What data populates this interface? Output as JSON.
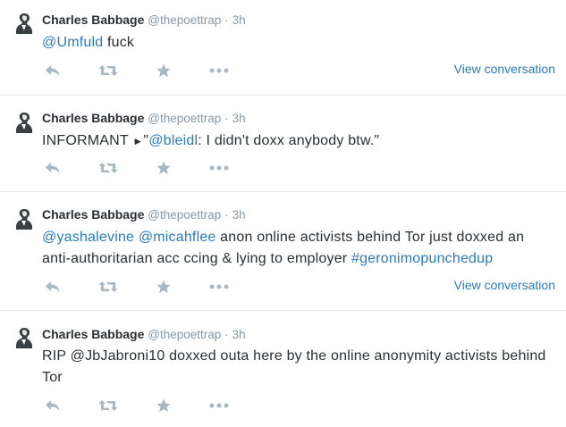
{
  "colors": {
    "link": "#2b7bb9",
    "muted": "#aab8c2",
    "text": "#292f33",
    "divider": "#e1e8ed"
  },
  "icons": {
    "reply": "reply-icon",
    "retweet": "retweet-icon",
    "favorite": "star-icon",
    "more": "more-icon"
  },
  "tweets": [
    {
      "author": {
        "name": "Charles Babbage",
        "handle": "@thepoettrap"
      },
      "separator": "·",
      "time": "3h",
      "text": [
        "@Umfuld",
        " fuck"
      ],
      "view_conversation": "View conversation"
    },
    {
      "author": {
        "name": "Charles Babbage",
        "handle": "@thepoettrap"
      },
      "separator": "·",
      "time": "3h",
      "text": [
        "INFORMANT ",
        "►",
        "\"",
        "@bleidl",
        ": I didn't doxx anybody btw.\""
      ]
    },
    {
      "author": {
        "name": "Charles Babbage",
        "handle": "@thepoettrap"
      },
      "separator": "·",
      "time": "3h",
      "text": [
        "@yashalevine",
        " ",
        "@micahflee",
        " anon online activists behind Tor just doxxed an anti-authoritarian acc ccing & lying to employer ",
        "#geronimopunchedup"
      ],
      "view_conversation": "View conversation"
    },
    {
      "author": {
        "name": "Charles Babbage",
        "handle": "@thepoettrap"
      },
      "separator": "·",
      "time": "3h",
      "text": [
        "RIP @JbJabroni10 doxxed outa here by the online anonymity activists behind Tor"
      ]
    }
  ]
}
